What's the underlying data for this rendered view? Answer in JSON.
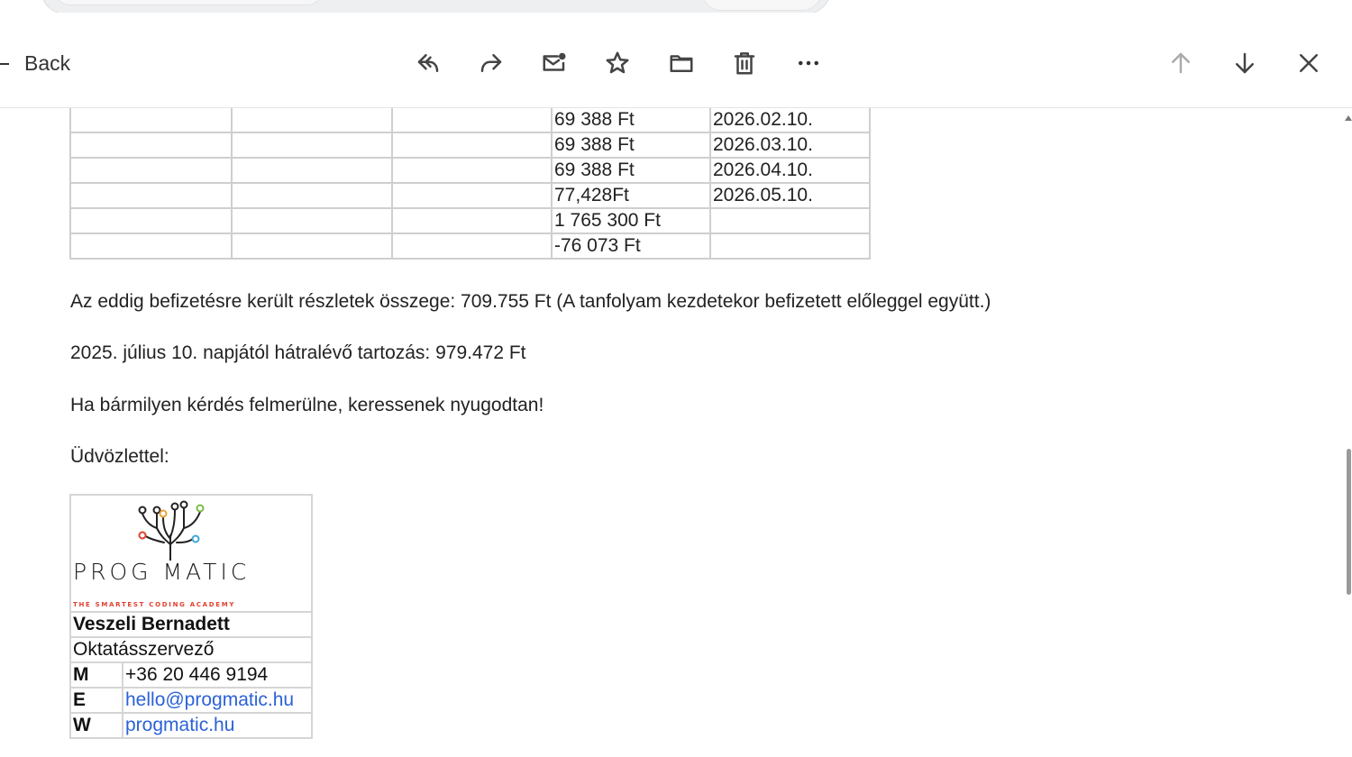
{
  "toolbar": {
    "back_label": "Back",
    "icons": [
      "reply-icon",
      "forward-icon",
      "mark-unread-icon",
      "star-icon",
      "folder-icon",
      "trash-icon",
      "more-icon",
      "up-arrow-icon",
      "down-arrow-icon",
      "close-icon"
    ]
  },
  "table": {
    "rows": [
      {
        "amount": "69 388 Ft",
        "date": "2026.02.10."
      },
      {
        "amount": "69 388 Ft",
        "date": "2026.03.10."
      },
      {
        "amount": "69 388 Ft",
        "date": "2026.04.10."
      },
      {
        "amount": "77,428Ft",
        "date": "2026.05.10."
      },
      {
        "amount": "1 765 300 Ft",
        "date": ""
      },
      {
        "amount": "-76 073 Ft",
        "date": ""
      }
    ]
  },
  "body": {
    "paid_summary": "Az eddig befizetésre került részletek összege: 709.755 Ft (A tanfolyam kezdetekor befizetett előleggel együtt.)",
    "remaining_debt": "2025. július 10. napjától hátralévő tartozás: 979.472 Ft",
    "questions": "Ha bármilyen kérdés felmerülne, keressenek nyugodtan!",
    "greeting": "Üdvözlettel:"
  },
  "signature": {
    "logo_text": "PROG MATIC",
    "logo_tagline": "THE SMARTEST CODING ACADEMY",
    "name": "Veszeli Bernadett",
    "role": "Oktatásszervező",
    "m_key": "M",
    "phone": "+36 20 446 9194",
    "e_key": "E",
    "email": "hello@progmatic.hu",
    "w_key": "W",
    "website": "progmatic.hu"
  },
  "colors": {
    "link": "#2a62d6",
    "tagline": "#e0412e"
  }
}
